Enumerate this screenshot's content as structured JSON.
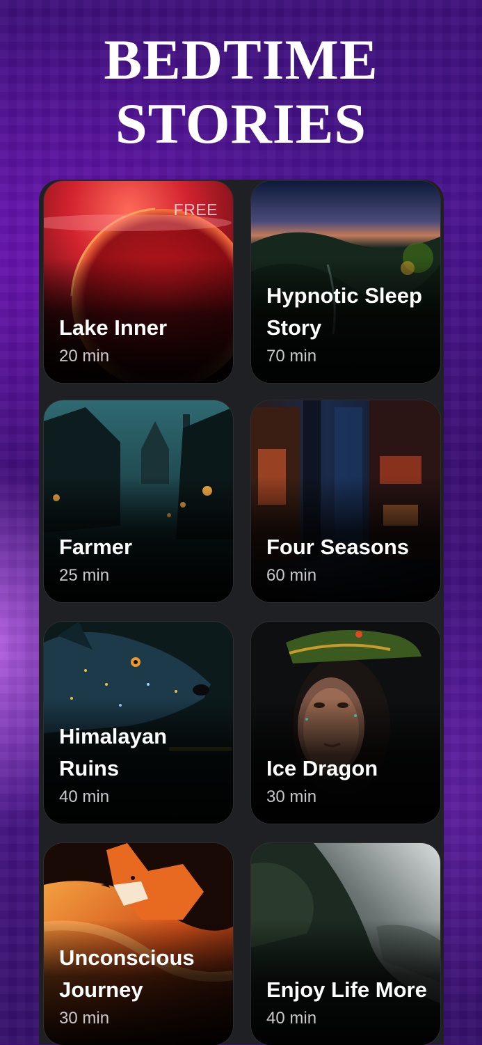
{
  "title": {
    "line1": "BEDTIME",
    "line2": "STORIES"
  },
  "stories": [
    {
      "name": "Lake Inner",
      "duration": "20 min",
      "badge": "FREE",
      "art": "red-sunset-art"
    },
    {
      "name": "Hypnotic Sleep Story",
      "duration": "70 min",
      "art": "night-valley-art"
    },
    {
      "name": "Farmer",
      "duration": "25 min",
      "art": "misty-village-art"
    },
    {
      "name": "Four Seasons",
      "duration": "60 min",
      "art": "dark-alley-art"
    },
    {
      "name": "Himalayan Ruins",
      "duration": "40 min",
      "art": "starry-wolf-art"
    },
    {
      "name": "Ice Dragon",
      "duration": "30 min",
      "art": "dragon-woman-art"
    },
    {
      "name": "Unconscious Journey",
      "duration": "30 min",
      "art": "fire-fox-art"
    },
    {
      "name": "Enjoy Life More",
      "duration": "40 min",
      "art": "misty-cliff-art"
    }
  ],
  "colors": {
    "background": "#3d0f7a",
    "panel": "#1f2023",
    "title_text": "#ffffff",
    "duration_text": "#c9c9cc"
  }
}
